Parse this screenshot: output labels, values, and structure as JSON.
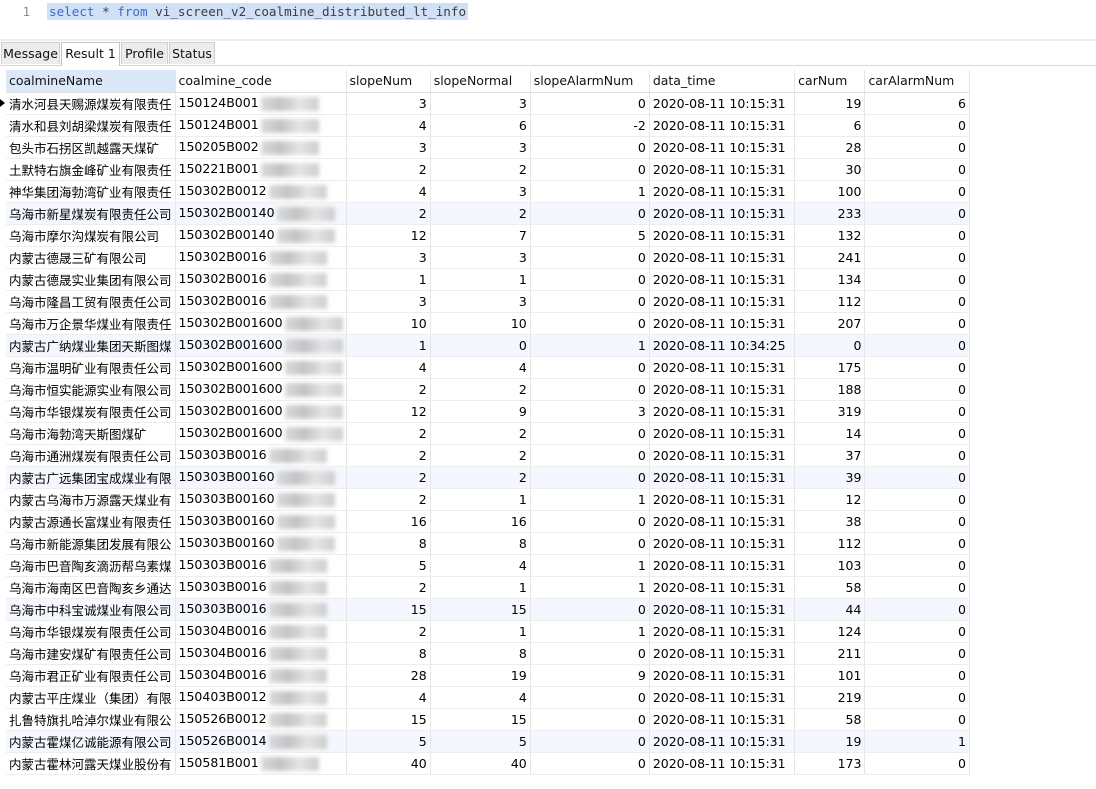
{
  "editor": {
    "line_number": "1",
    "sql_keyword_select": "select",
    "sql_star": " * ",
    "sql_keyword_from": "from",
    "sql_table": " vi_screen_v2_coalmine_distributed_lt_info"
  },
  "tabs": [
    {
      "label": "Message"
    },
    {
      "label": "Result 1"
    },
    {
      "label": "Profile"
    },
    {
      "label": "Status"
    }
  ],
  "columns": [
    "coalmineName",
    "coalmine_code",
    "slopeNum",
    "slopeNormal",
    "slopeAlarmNum",
    "data_time",
    "carNum",
    "carAlarmNum"
  ],
  "rows": [
    [
      "清水河县天赐源煤炭有限责任",
      "150124B001",
      "3",
      "3",
      "0",
      "2020-08-11 10:15:31",
      "19",
      "6"
    ],
    [
      "清水和县刘胡梁煤炭有限责任",
      "150124B001",
      "4",
      "6",
      "-2",
      "2020-08-11 10:15:31",
      "6",
      "0"
    ],
    [
      "包头市石拐区凯越露天煤矿",
      "150205B002",
      "3",
      "3",
      "0",
      "2020-08-11 10:15:31",
      "28",
      "0"
    ],
    [
      "土默特右旗金峰矿业有限责任",
      "150221B001",
      "2",
      "2",
      "0",
      "2020-08-11 10:15:31",
      "30",
      "0"
    ],
    [
      "神华集团海勃湾矿业有限责任",
      "150302B0012",
      "4",
      "3",
      "1",
      "2020-08-11 10:15:31",
      "100",
      "0"
    ],
    [
      "乌海市新星煤炭有限责任公司",
      "150302B00140",
      "2",
      "2",
      "0",
      "2020-08-11 10:15:31",
      "233",
      "0"
    ],
    [
      "乌海市摩尔沟煤炭有限公司",
      "150302B00140",
      "12",
      "7",
      "5",
      "2020-08-11 10:15:31",
      "132",
      "0"
    ],
    [
      "内蒙古德晟三矿有限公司",
      "150302B0016",
      "3",
      "3",
      "0",
      "2020-08-11 10:15:31",
      "241",
      "0"
    ],
    [
      "内蒙古德晟实业集团有限公司",
      "150302B0016",
      "1",
      "1",
      "0",
      "2020-08-11 10:15:31",
      "134",
      "0"
    ],
    [
      "乌海市隆昌工贸有限责任公司",
      "150302B0016",
      "3",
      "3",
      "0",
      "2020-08-11 10:15:31",
      "112",
      "0"
    ],
    [
      "乌海市万企景华煤业有限责任",
      "150302B001600",
      "10",
      "10",
      "0",
      "2020-08-11 10:15:31",
      "207",
      "0"
    ],
    [
      "内蒙古广纳煤业集团天斯图煤",
      "150302B001600",
      "1",
      "0",
      "1",
      "2020-08-11 10:34:25",
      "0",
      "0"
    ],
    [
      "乌海市温明矿业有限责任公司",
      "150302B001600",
      "4",
      "4",
      "0",
      "2020-08-11 10:15:31",
      "175",
      "0"
    ],
    [
      "乌海市恒实能源实业有限公司",
      "150302B001600",
      "2",
      "2",
      "0",
      "2020-08-11 10:15:31",
      "188",
      "0"
    ],
    [
      "乌海市华银煤炭有限责任公司",
      "150302B001600",
      "12",
      "9",
      "3",
      "2020-08-11 10:15:31",
      "319",
      "0"
    ],
    [
      "乌海市海勃湾天斯图煤矿",
      "150302B001600",
      "2",
      "2",
      "0",
      "2020-08-11 10:15:31",
      "14",
      "0"
    ],
    [
      "乌海市通洲煤炭有限责任公司",
      "150303B0016",
      "2",
      "2",
      "0",
      "2020-08-11 10:15:31",
      "37",
      "0"
    ],
    [
      "内蒙古广远集团宝成煤业有限",
      "150303B00160",
      "2",
      "2",
      "0",
      "2020-08-11 10:15:31",
      "39",
      "0"
    ],
    [
      "内蒙古乌海市万源露天煤业有",
      "150303B00160",
      "2",
      "1",
      "1",
      "2020-08-11 10:15:31",
      "12",
      "0"
    ],
    [
      "内蒙古源通长富煤业有限责任",
      "150303B00160",
      "16",
      "16",
      "0",
      "2020-08-11 10:15:31",
      "38",
      "0"
    ],
    [
      "乌海市新能源集团发展有限公",
      "150303B00160",
      "8",
      "8",
      "0",
      "2020-08-11 10:15:31",
      "112",
      "0"
    ],
    [
      "乌海市巴音陶亥滴沥帮乌素煤",
      "150303B0016",
      "5",
      "4",
      "1",
      "2020-08-11 10:15:31",
      "103",
      "0"
    ],
    [
      "乌海市海南区巴音陶亥乡通达",
      "150303B0016",
      "2",
      "1",
      "1",
      "2020-08-11 10:15:31",
      "58",
      "0"
    ],
    [
      "乌海市中科宝诚煤业有限公司",
      "150303B0016",
      "15",
      "15",
      "0",
      "2020-08-11 10:15:31",
      "44",
      "0"
    ],
    [
      "乌海市华银煤炭有限责任公司",
      "150304B0016",
      "2",
      "1",
      "1",
      "2020-08-11 10:15:31",
      "124",
      "0"
    ],
    [
      "乌海市建安煤矿有限责任公司",
      "150304B0016",
      "8",
      "8",
      "0",
      "2020-08-11 10:15:31",
      "211",
      "0"
    ],
    [
      "乌海市君正矿业有限责任公司",
      "150304B0016",
      "28",
      "19",
      "9",
      "2020-08-11 10:15:31",
      "101",
      "0"
    ],
    [
      "内蒙古平庄煤业（集团）有限",
      "150403B0012",
      "4",
      "4",
      "0",
      "2020-08-11 10:15:31",
      "219",
      "0"
    ],
    [
      "扎鲁特旗扎哈淖尔煤业有限公",
      "150526B0012",
      "15",
      "15",
      "0",
      "2020-08-11 10:15:31",
      "58",
      "0"
    ],
    [
      "内蒙古霍煤亿诚能源有限公司",
      "150526B0014",
      "5",
      "5",
      "0",
      "2020-08-11 10:15:31",
      "19",
      "1"
    ],
    [
      "内蒙古霍林河露天煤业股份有",
      "150581B001",
      "40",
      "40",
      "0",
      "2020-08-11 10:15:31",
      "173",
      "0"
    ]
  ]
}
